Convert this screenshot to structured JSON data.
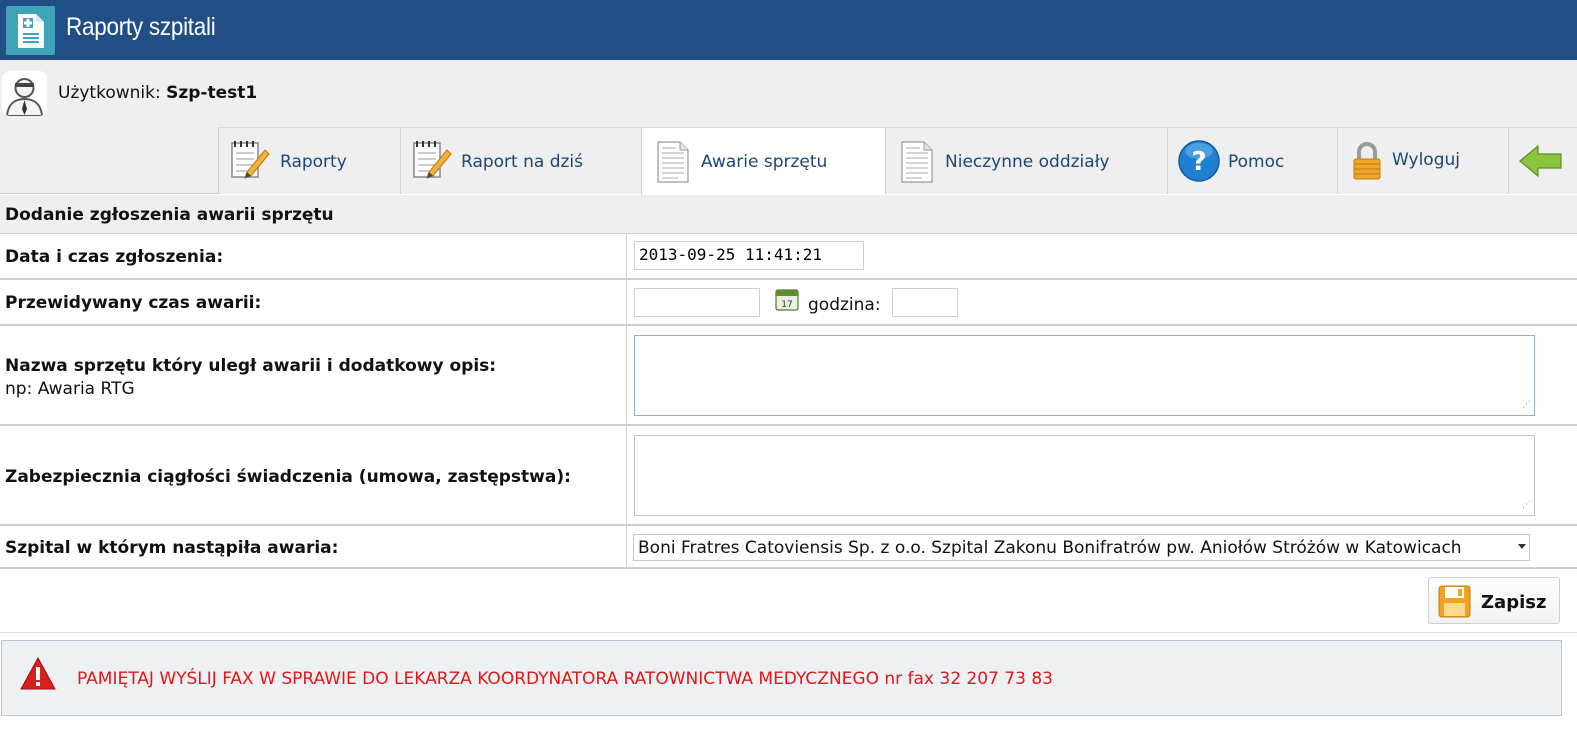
{
  "app": {
    "title": "Raporty szpitali",
    "logo_icon": "medical-document-icon"
  },
  "user": {
    "label": "Użytkownik:",
    "name": "Szp-test1",
    "avatar_icon": "doctor-avatar-icon"
  },
  "tabs": [
    {
      "label": "Raporty",
      "icon": "notepad-pencil-icon",
      "active": false
    },
    {
      "label": "Raport na dziś",
      "icon": "notepad-pencil-icon",
      "active": false
    },
    {
      "label": "Awarie sprzętu",
      "icon": "document-icon",
      "active": true
    },
    {
      "label": "Nieczynne oddziały",
      "icon": "document-icon",
      "active": false
    },
    {
      "label": "Pomoc",
      "icon": "help-icon",
      "active": false
    },
    {
      "label": "Wyloguj",
      "icon": "lock-icon",
      "active": false
    },
    {
      "label": "",
      "icon": "back-arrow-icon",
      "active": false
    }
  ],
  "form": {
    "header": "Dodanie zgłoszenia awarii sprzętu",
    "date_label": "Data i czas zgłoszenia:",
    "date_value": "2013-09-25 11:41:21",
    "expected_label": "Przewidywany czas awarii:",
    "expected_date_value": "",
    "hour_label": "godzina:",
    "hour_value": "",
    "equipment_label": "Nazwa sprzętu który uległ awarii i dodatkowy opis:",
    "equipment_hint": "np: Awaria RTG",
    "equipment_value": "",
    "continuity_label": "Zabezpiecznia ciągłości świadczenia (umowa, zastępstwa):",
    "continuity_value": "",
    "hospital_label": "Szpital w którym nastąpiła awaria:",
    "hospital_selected": "Boni Fratres Catoviensis Sp. z o.o. Szpital Zakonu Bonifratrów pw. Aniołów Stróżów w Katowicach"
  },
  "save": {
    "label": "Zapisz",
    "icon": "floppy-disk-icon"
  },
  "alert": {
    "icon": "warning-icon",
    "message": "PAMIĘTAJ WYŚLIJ FAX W SPRAWIE DO LEKARZA KOORDYNATORA RATOWNICTWA MEDYCZNEGO nr fax 32 207 73 83",
    "color": "#e51616"
  },
  "colors": {
    "header": "#214f85",
    "tab_text": "#1c4677",
    "alert_text": "#e51616"
  }
}
